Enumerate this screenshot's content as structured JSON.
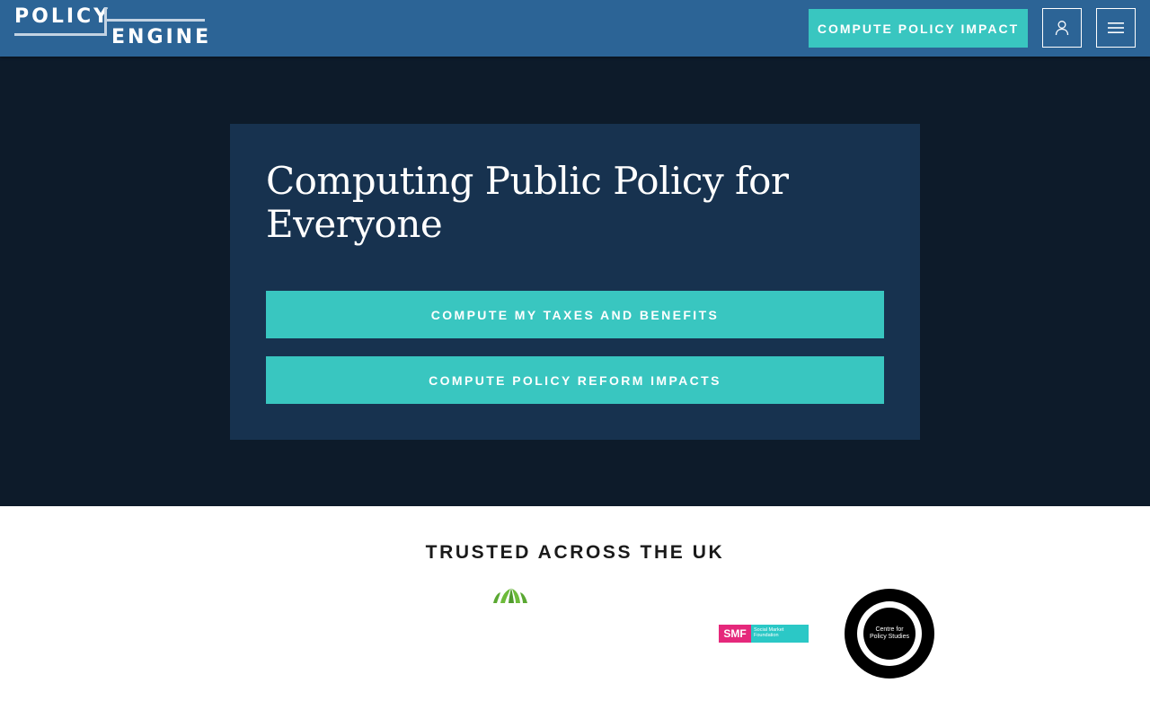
{
  "header": {
    "logo_line1": "POLICY",
    "logo_line2": "ENGINE",
    "cta_label": "COMPUTE POLICY IMPACT",
    "user_icon": "user-icon",
    "menu_icon": "hamburger-menu-icon"
  },
  "hero": {
    "title": "Computing Public Policy for Everyone",
    "buttons": [
      "COMPUTE MY TAXES AND BENEFITS",
      "COMPUTE POLICY REFORM IMPACTS"
    ]
  },
  "trusted": {
    "title": "TRUSTED ACROSS THE UK",
    "logos": [
      {
        "name": "green-leaf-logo"
      },
      {
        "name": "smf-logo",
        "abbr": "SMF",
        "text": "Social Market Foundation"
      },
      {
        "name": "cps-logo",
        "text": "Centre for Policy Studies"
      }
    ]
  },
  "colors": {
    "header_bg": "#2c6496",
    "hero_bg": "#0d1b2a",
    "card_bg": "#17324f",
    "accent_teal": "#39c6c0",
    "smf_pink": "#e5287b",
    "smf_teal": "#2bc8c6"
  }
}
